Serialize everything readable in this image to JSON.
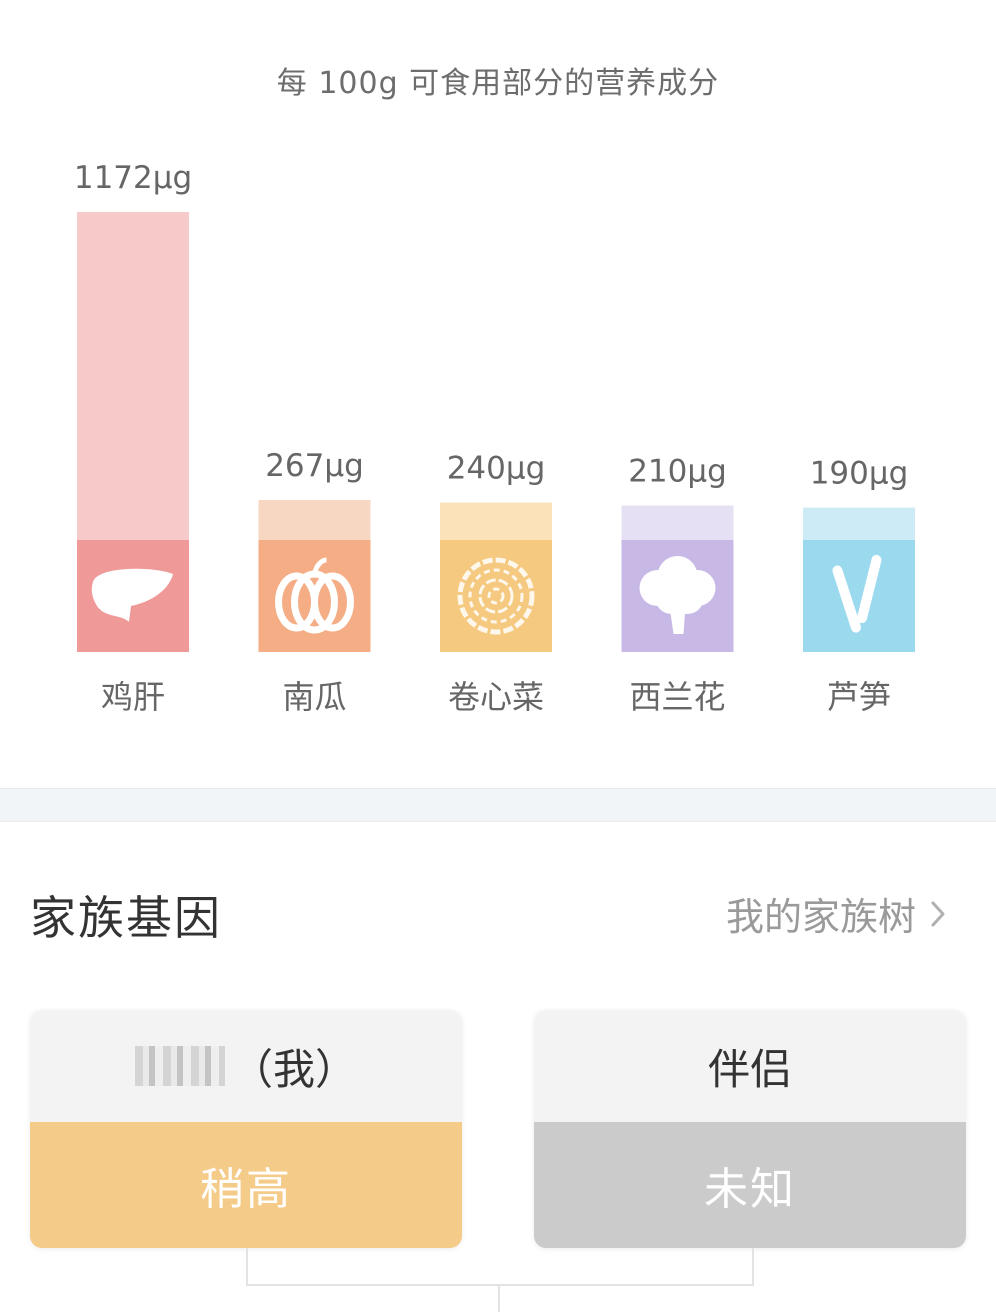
{
  "chart_title": "每 100g 可食用部分的营养成分",
  "chart_data": {
    "type": "bar",
    "title": "每 100g 可食用部分的营养成分",
    "unit": "μg",
    "categories": [
      "鸡肝",
      "南瓜",
      "卷心菜",
      "西兰花",
      "芦笋"
    ],
    "values": [
      1172,
      267,
      240,
      210,
      190
    ],
    "value_labels": [
      "1172μg",
      "267μg",
      "240μg",
      "210μg",
      "190μg"
    ],
    "icons": [
      "liver-icon",
      "pumpkin-icon",
      "cabbage-icon",
      "broccoli-icon",
      "asparagus-icon"
    ],
    "colors": [
      {
        "light": "#f7caca",
        "dark": "#ef9a98"
      },
      {
        "light": "#f8d7c2",
        "dark": "#f4ad84"
      },
      {
        "light": "#fbe2b8",
        "dark": "#f5c97f"
      },
      {
        "light": "#e5e0f3",
        "dark": "#c8b8e6"
      },
      {
        "light": "#cdebf6",
        "dark": "#9bd9ef"
      }
    ]
  },
  "family_section": {
    "title": "家族基因",
    "tree_link": "我的家族树",
    "cards": [
      {
        "name": "（我）",
        "status": "稍高"
      },
      {
        "name": "伴侣",
        "status": "未知"
      }
    ]
  }
}
